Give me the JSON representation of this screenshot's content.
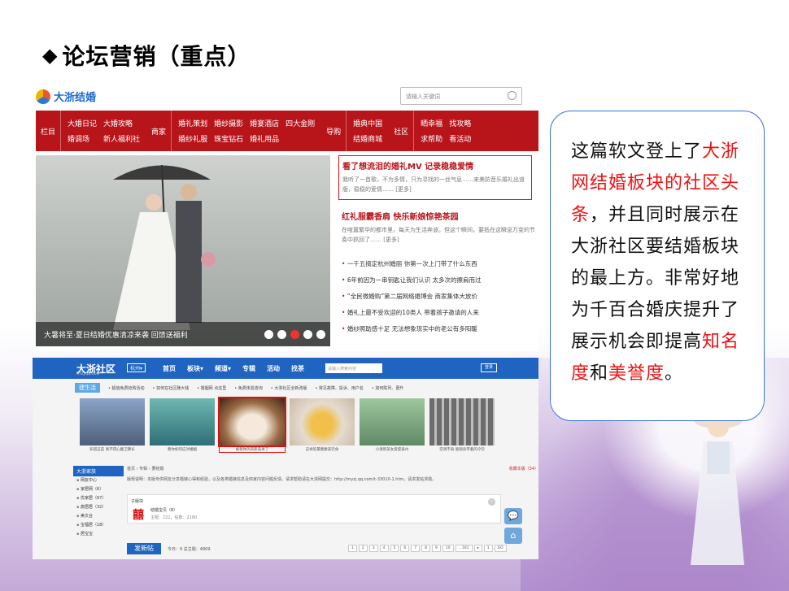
{
  "heading": {
    "bullet": "◆",
    "text": "论坛营销（重点）"
  },
  "shot1": {
    "logo": "大浙结婚",
    "search_placeholder": "请输入关键词",
    "nav": [
      {
        "category": "栏目",
        "links": [
          "大婚日记",
          "大婚攻略",
          "婚调场",
          "新人福利社"
        ]
      },
      {
        "category": "商家",
        "links": [
          "婚礼策划",
          "婚纱摄影",
          "婚宴酒店",
          "四大金刚",
          "婚纱礼服",
          "珠宝钻石",
          "婚礼用品"
        ]
      },
      {
        "category": "导购",
        "links": [
          "婚典中国",
          "结婚商城"
        ]
      },
      {
        "category": "社区",
        "links": [
          "晒幸福",
          "找攻略",
          "求帮助",
          "看活动"
        ]
      }
    ],
    "photo_caption": "大暑将至·夏日结婚优惠清凉来袭 回馈送福利",
    "feature": {
      "title": "看了想流泪的婚礼MV 记录稳稳爱情",
      "desc": "我听了一首歌，不为多情，只为寻找的一丝气息……来美防音乐婚礼出道版，稳稳的爱情…… [更多]"
    },
    "section2": {
      "title": "红礼服霸香肩 快乐新娘惊艳茶园",
      "desc": "在喧嚣繁华的都市里，每天为生活奔波。但这个瞬间，要抵在这瞬息万变的节奏中抓回了…… [更多]"
    },
    "list": [
      "一千五搞定杭州婚丽 你第一次上门带了什么东西",
      "6年前因为一串钥匙让我们认识 太多次的擦肩而过",
      "“全民微婚购”第二届网络婚博会 商家集体大放价",
      "婚礼上最不受欢迎的10类人 带着孩子邀请的人来",
      "婚纱照助感十足 无法想象现实中的老公有多阳暖"
    ]
  },
  "shot2": {
    "brand": "大浙社区",
    "brand_sub": "MYZJ.QQ.COM",
    "city": "杭州▾",
    "menu": [
      "首页",
      "板块▾",
      "频道▾",
      "专辑",
      "活动",
      "找茶"
    ],
    "search_placeholder": "请输入搜索内容",
    "login": "登录",
    "ticker_tag": "建生活",
    "ticker": [
      "• 超值免费抢购活动",
      "• 如何在社区赚大钱",
      "• 婚姻网 点这里",
      "• 免费体验咨询",
      "• 大浙社区全新改版",
      "• 常见故障、投诉、用户名",
      "• 如何陈列、晋升"
    ],
    "thumbs": [
      "知道这是 真不得心酸卫算长",
      "教你如何应对婚姻",
      "被帮你的背影美呆了",
      "这样吃最健康美饮食",
      "小清新美女爱度泰州",
      "空调不再 能随身带着的冷饮"
    ],
    "sidebar_head": "大浙家族",
    "sidebar": [
      "网友中心",
      "家居网（6）",
      "优家居（67）",
      "旅居居（32）",
      "美文台",
      "宝福居（18）",
      "居宝宝"
    ],
    "crumb": "首页 › 专辑 › 要结婚",
    "fav": "收藏本版（34）",
    "desc": "版规说明：本版专供网友分享婚嫁心得和经验，以及各类婚嫁信息及商家内容问题反馈。请求帮助请在大浙网提交：http://myzj.qq.com/t-33010-1.htm，请求发帖求助。",
    "post_label": "子版块",
    "post_char": "囍",
    "post_name": "结婚宝贝（8）",
    "post_stats": "主题：221，帖数：2180",
    "post_btn": "发新帖",
    "stats": "今日：9  总主题：4809",
    "pager": [
      "1",
      "2",
      "3",
      "4",
      "5",
      "6",
      "7",
      "8",
      "9",
      "10",
      "...161",
      "▸",
      "1",
      "GO"
    ],
    "float": [
      "💬",
      "⌂"
    ]
  },
  "callout": {
    "t1": "这篇软文登上了",
    "h1": "大浙网结婚板块的社区头条",
    "t2": "，并且同时展示在大浙社区要结婚板块的最上方。非常好地为千百合婚庆提升了展示机会即提高",
    "h2": "知名度",
    "t3": "和",
    "h3": "美誉度",
    "t4": "。"
  }
}
